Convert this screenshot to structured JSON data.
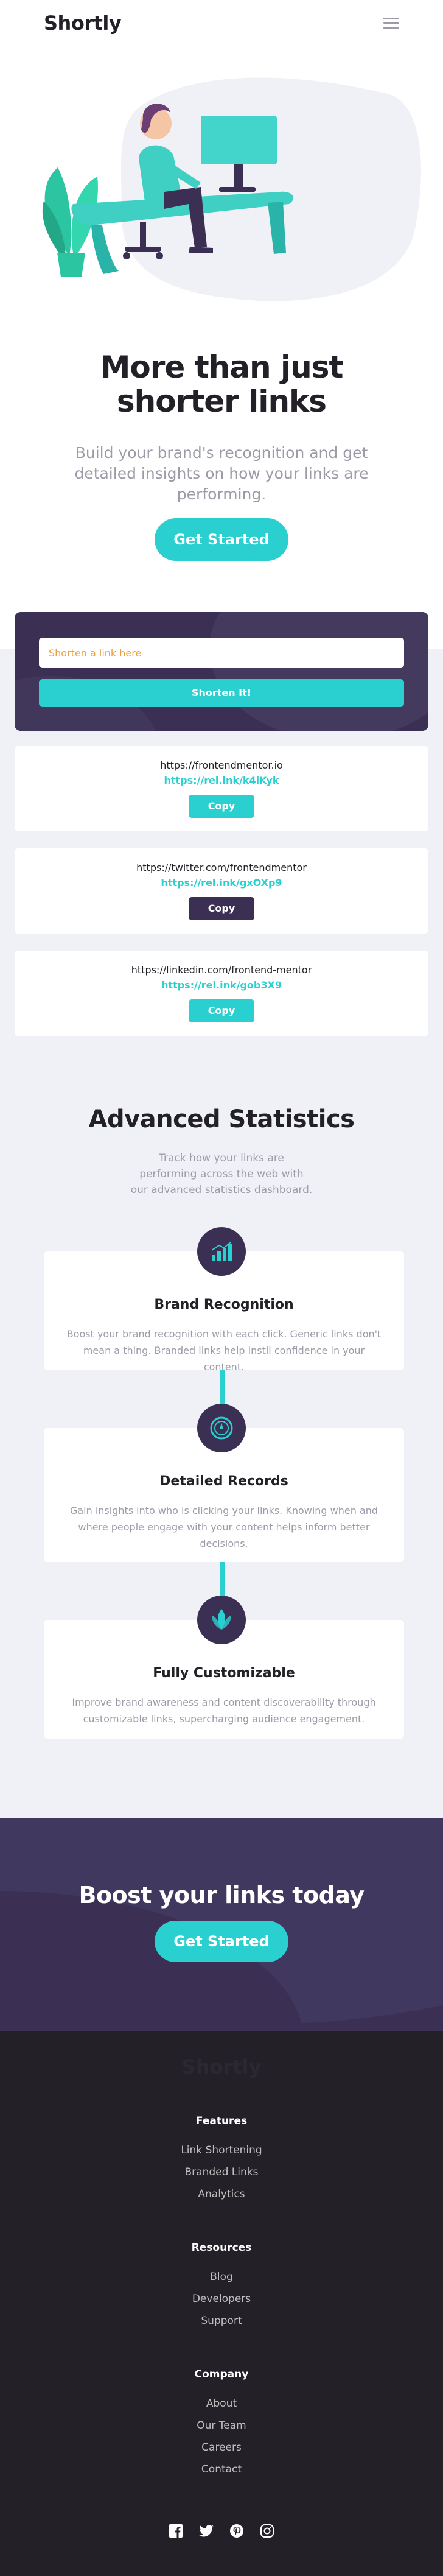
{
  "header": {
    "logo": "Shortly"
  },
  "hero": {
    "title": "More than just shorter links",
    "subtitle": "Build your brand's recognition and get detailed insights on how your links are performing.",
    "cta": "Get Started"
  },
  "shorten": {
    "placeholder": "Shorten a link here",
    "button": "Shorten It!"
  },
  "links": [
    {
      "original": "https://frontendmentor.io",
      "short": "https://rel.ink/k4lKyk",
      "button": "Copy"
    },
    {
      "original": "https://twitter.com/frontendmentor",
      "short": "https://rel.ink/gxOXp9",
      "button": "Copy"
    },
    {
      "original": "https://linkedin.com/frontend-mentor",
      "short": "https://rel.ink/gob3X9",
      "button": "Copy"
    }
  ],
  "stats": {
    "title": "Advanced Statistics",
    "subtitle": "Track how your links are performing across the web with our advanced statistics dashboard.",
    "cards": [
      {
        "icon": "chart-icon",
        "title": "Brand Recognition",
        "text": "Boost your brand recognition with each click. Generic links don't mean a thing. Branded links help instil confidence in your content."
      },
      {
        "icon": "gauge-icon",
        "title": "Detailed Records",
        "text": "Gain insights into who is clicking your links. Knowing when and where people engage with your content helps inform better decisions."
      },
      {
        "icon": "brush-icon",
        "title": "Fully Customizable",
        "text": "Improve brand awareness and content discoverability through customizable links, supercharging audience engagement."
      }
    ]
  },
  "boost": {
    "title": "Boost your links today",
    "cta": "Get Started"
  },
  "footer": {
    "logo": "Shortly",
    "columns": [
      {
        "title": "Features",
        "links": [
          "Link Shortening",
          "Branded Links",
          "Analytics"
        ]
      },
      {
        "title": "Resources",
        "links": [
          "Blog",
          "Developers",
          "Support"
        ]
      },
      {
        "title": "Company",
        "links": [
          "About",
          "Our Team",
          "Careers",
          "Contact"
        ]
      }
    ],
    "socials": [
      "facebook-icon",
      "twitter-icon",
      "pinterest-icon",
      "instagram-icon"
    ]
  },
  "colors": {
    "cyan": "#2acfcf",
    "dark_violet": "#3b3054",
    "gray": "#9e9aa7",
    "very_dark": "#232127",
    "red": "#f46262"
  }
}
